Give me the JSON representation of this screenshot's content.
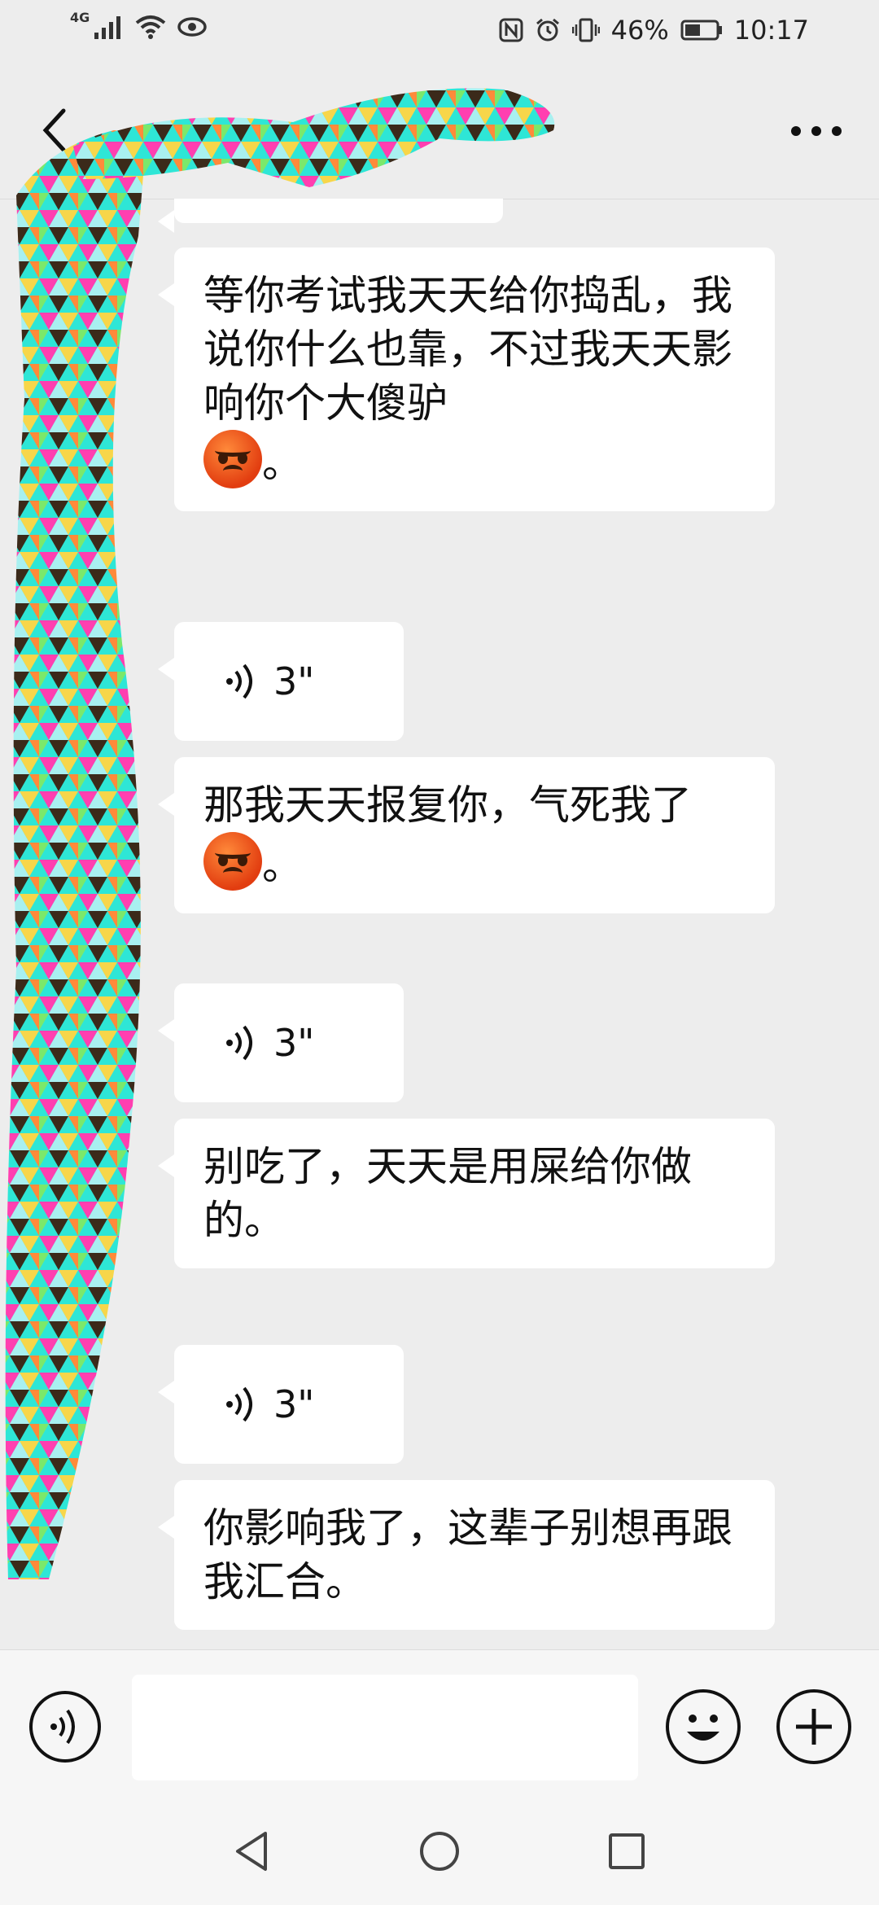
{
  "status_bar": {
    "network": "4G",
    "battery": "46%",
    "time": "10:17"
  },
  "title_bar": {
    "title": ""
  },
  "messages": [
    {
      "type": "text",
      "text": "等你考试我天天给你捣乱，我说你什么也靠，不过我天天影响你个大傻驴",
      "tail": "。",
      "emoji": "angry-face"
    },
    {
      "type": "voice",
      "duration": "3\""
    },
    {
      "type": "text",
      "text": "那我天天报复你，气死我了",
      "tail": "。",
      "emoji": "angry-face"
    },
    {
      "type": "voice",
      "duration": "3\""
    },
    {
      "type": "text",
      "text": "别吃了，天天是用屎给你做的。"
    },
    {
      "type": "voice",
      "duration": "3\""
    },
    {
      "type": "text",
      "text": "你影响我了，这辈子别想再跟我汇合。"
    }
  ],
  "input_bar": {
    "value": "",
    "placeholder": ""
  },
  "colors": {
    "background": "#ededed",
    "bubble": "#ffffff",
    "input_bar": "#f6f6f6"
  }
}
